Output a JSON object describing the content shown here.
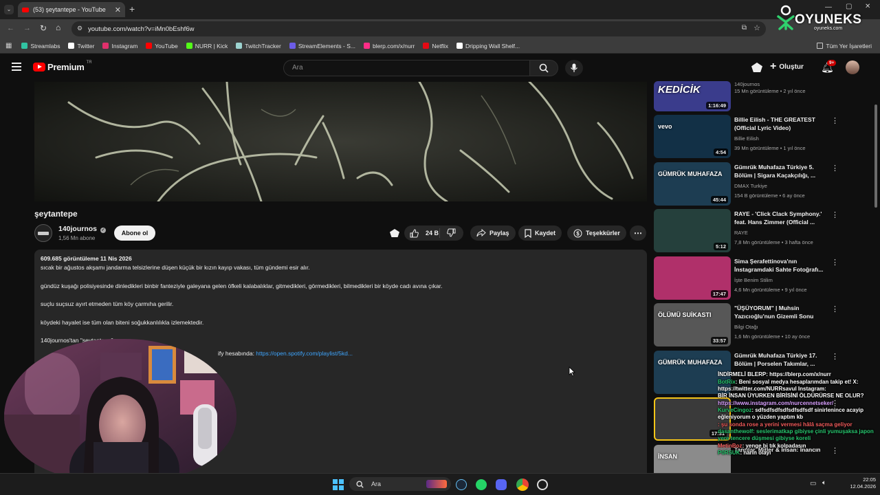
{
  "browser": {
    "tab_title": "(53) şeytantepe - YouTube",
    "url": "youtube.com/watch?v=iMn0bEshf6w",
    "bookmarks": [
      {
        "label": "Streamlabs",
        "color": "#31c3a2"
      },
      {
        "label": "Twitter",
        "color": "#ffffff"
      },
      {
        "label": "Instagram",
        "color": "#e1306c"
      },
      {
        "label": "YouTube",
        "color": "#ff0000"
      },
      {
        "label": "NURR | Kick",
        "color": "#53fc18"
      },
      {
        "label": "TwitchTracker",
        "color": "#9cd3d0"
      },
      {
        "label": "StreamElements - S...",
        "color": "#6c5ce7"
      },
      {
        "label": "blerp.com/x/nurr",
        "color": "#ff2d87"
      },
      {
        "label": "Netflix",
        "color": "#e50914"
      },
      {
        "label": "Dripping Wall Shelf...",
        "color": "#ffffff"
      }
    ],
    "all_bookmarks": "Tüm Yer İşaretleri"
  },
  "youtube": {
    "logo": "Premium",
    "logo_region": "TR",
    "search_placeholder": "Ara",
    "create_label": "Oluştur",
    "notif_count": "9+"
  },
  "video": {
    "title": "şeytantepe",
    "channel": "140journos",
    "subscribers": "1,56 Mn abone",
    "subscribe_label": "Abone ol",
    "likes": "24 B",
    "share_label": "Paylaş",
    "save_label": "Kaydet",
    "thanks_label": "Teşekkürler"
  },
  "description": {
    "stats": "609.685 görüntüleme  11 Nis 2026",
    "lines": [
      "sıcak bir ağustos akşamı jandarma telsizlerine düşen küçük bir kızın kayıp vakası, tüm gündemi esir alır.",
      "gündüz kuşağı polisiyesinde dinledikleri binbir fanteziyle galeyana gelen öfkeli kalabalıklar, gitmedikleri, görmedikleri, bilmedikleri bir köyde cadı avına çıkar.",
      "suçlu suçsuz ayırt etmeden tüm köy çarmıha gerilir.",
      "köydeki hayalet ise tüm olan biteni soğukkanlılıkla izlemektedir.",
      "140journos'tan \"şeytantepe\""
    ],
    "spotify_prefix": "ify hesabında: ",
    "spotify_link": "https://open.spotify.com/playlist/5kd..."
  },
  "recommendations": [
    {
      "title": "",
      "channel": "140journos",
      "views": "15 Mn görüntüleme • 2 yıl önce",
      "duration": "1:16:49",
      "thumb_text": "KEDİCİK",
      "bg": "#3a3c8c"
    },
    {
      "title": "Billie Eilish - THE GREATEST (Official Lyric Video)",
      "channel": "Billie Eilish",
      "views": "39 Mn görüntüleme • 1 yıl önce",
      "duration": "4:54",
      "thumb_text": "vevo",
      "bg": "#123046"
    },
    {
      "title": "Gümrük Muhafaza Türkiye 5. Bölüm | Sigara Kaçakçılığı, ...",
      "channel": "DMAX Turkiye",
      "views": "154 B görüntüleme • 6 ay önce",
      "duration": "45:44",
      "thumb_text": "GÜMRÜK MUHAFAZA",
      "bg": "#1d3d52"
    },
    {
      "title": "RAYE - 'Click Clack Symphony.' feat. Hans Zimmer (Official ...",
      "channel": "RAYE",
      "views": "7,8 Mn görüntüleme • 3 hafta önce",
      "duration": "5:12",
      "thumb_text": "",
      "bg": "#25403c"
    },
    {
      "title": "Sima Şerafettinova'nın İnstagramdaki Sahte Fotoğrafı...",
      "channel": "İşte Benim Stilim",
      "views": "4,6 Mn görüntüleme • 9 yıl önce",
      "duration": "17:47",
      "thumb_text": "",
      "bg": "#b0306a"
    },
    {
      "title": "\"ÜŞÜYORUM\" | Muhsin Yazıcıoğlu'nun Gizemli Sonu",
      "channel": "Bilgi Otağı",
      "views": "1,6 Mn görüntüleme • 10 ay önce",
      "duration": "33:57",
      "thumb_text": "ÖLÜMÜ SUİKASTI",
      "bg": "#575757"
    },
    {
      "title": "Gümrük Muhafaza Türkiye 17. Bölüm | Porselen Takımlar, ...",
      "channel": "",
      "views": "",
      "duration": "",
      "thumb_text": "GÜMRÜK MUHAFAZA",
      "bg": "#1d3d52"
    },
    {
      "title": "",
      "channel": "",
      "views": "",
      "duration": "17:31",
      "thumb_text": "",
      "bg": "#3a3a3a"
    },
    {
      "title": "Tanrılar, Mitler & İnsan: İnancın",
      "channel": "",
      "views": "",
      "duration": "",
      "thumb_text": "İNSAN",
      "bg": "#8b8b8b"
    }
  ],
  "overlay": {
    "brand": "OYUNEKS",
    "brand_url": "oyuneks.com",
    "chat": [
      {
        "user": "",
        "text": "İNDİRMELİ BLERP: https://blerp.com/x/nurr",
        "cls": ""
      },
      {
        "user": "BotRix",
        "text": ": Beni sosyal medya hesaplarımdan takip et! X: https://twitter.com/NURRsavul Instagram:",
        "cls": "u"
      },
      {
        "user": "",
        "text": "BİR İNSAN ÜYURKEN BİRİSİNİ ÖLDÜRÜRSE NE OLUR?",
        "cls": ""
      },
      {
        "user": "",
        "text": "https://www.instagram.com/nurcennetseker/",
        "cls": "u2"
      },
      {
        "user": "KurveCingoz",
        "text": ": sdfsdfsdfsdfsdfsdfsdf sinirlenince acayip eğleniyorum o yüzden yaptım kb",
        "cls": "u"
      },
      {
        "user": "",
        "text": ": şu sonda rose a yerini vermesi hâlâ saçma geliyor",
        "cls": "u3"
      },
      {
        "user": "",
        "text": "dasanthewolf: seslerimatkap gibiyse çinli yumuşaksa japon yere tencere düşmesi gibiyse koreli",
        "cls": "u"
      },
      {
        "user": "MetinBoz",
        "text": ": yenge bi tık kolpadasın",
        "cls": "u3"
      },
      {
        "user": "P0RSUK",
        "text": ": narin olayı",
        "cls": "u"
      }
    ]
  },
  "taskbar": {
    "search": "Ara",
    "time": "22:05",
    "date": "12.04.2026"
  }
}
